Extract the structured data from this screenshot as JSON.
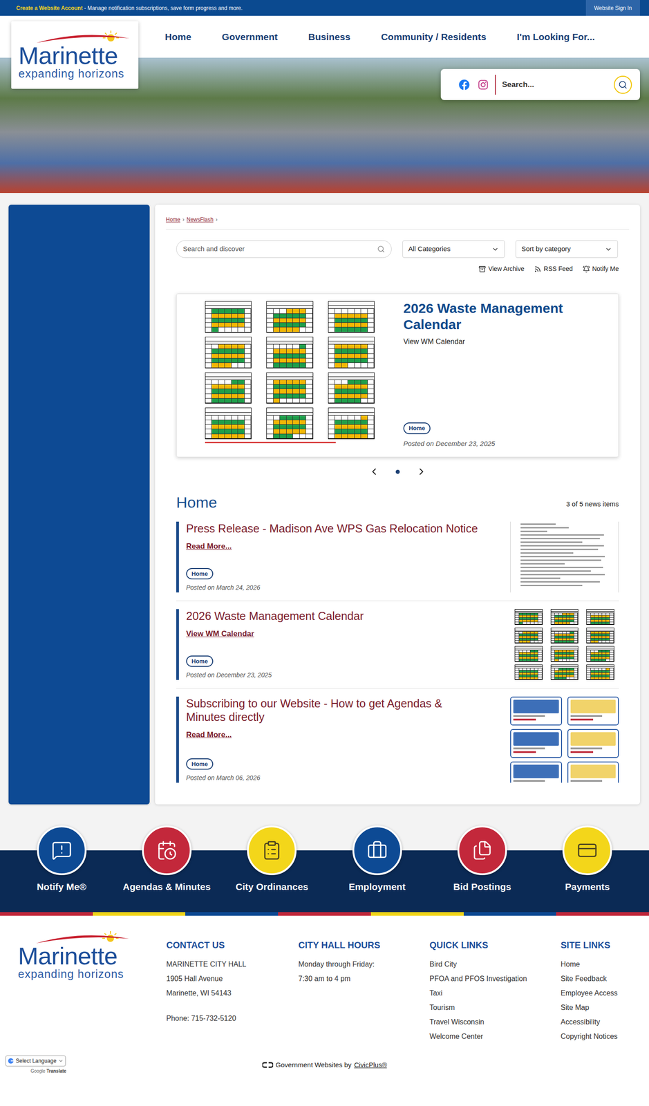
{
  "top_bar": {
    "account_link": "Create a Website Account",
    "message": " - Manage notification subscriptions, save form progress and more.",
    "sign_in": "Website Sign In"
  },
  "logo": {
    "name": "Marinette",
    "tagline": "expanding horizons"
  },
  "nav": [
    {
      "label": "Home"
    },
    {
      "label": "Government"
    },
    {
      "label": "Business"
    },
    {
      "label": "Community / Residents"
    },
    {
      "label": "I'm Looking For..."
    }
  ],
  "site_search": {
    "placeholder": "Search..."
  },
  "breadcrumb": {
    "items": [
      "Home",
      "NewsFlash"
    ],
    "separator": "›"
  },
  "filters": {
    "search_placeholder": "Search and discover",
    "category": "All Categories",
    "sort": "Sort by category"
  },
  "actions": [
    "View Archive",
    "RSS Feed",
    "Notify Me"
  ],
  "featured": {
    "title": "2026 Waste Management Calendar",
    "link": "View WM Calendar",
    "tag": "Home",
    "posted": "Posted on December 23, 2025"
  },
  "carousel": {
    "dots": [
      {
        "selected": true
      }
    ]
  },
  "section": {
    "title": "Home",
    "count": "3 of 5 news items"
  },
  "news": [
    {
      "title": "Press Release - Madison Ave WPS Gas Relocation Notice",
      "link": "Read More...",
      "tag": "Home",
      "posted": "Posted on March 24, 2026",
      "kind": "document"
    },
    {
      "title": "2026 Waste Management Calendar",
      "link": "View WM Calendar",
      "tag": "Home",
      "posted": "Posted on December 23, 2025",
      "kind": "calendar"
    },
    {
      "title": "Subscribing to our Website - How to get Agendas & Minutes directly",
      "link": "Read More...",
      "tag": "Home",
      "posted": "Posted on March 06, 2026",
      "kind": "screenshots"
    }
  ],
  "quick_links": [
    {
      "label": "Notify Me®",
      "color": "#0d4a94"
    },
    {
      "label": "Agendas & Minutes",
      "color": "#c3283b"
    },
    {
      "label": "City Ordinances",
      "color": "#f3d61a"
    },
    {
      "label": "Employment",
      "color": "#0d4a94"
    },
    {
      "label": "Bid Postings",
      "color": "#c3283b"
    },
    {
      "label": "Payments",
      "color": "#f3d61a"
    }
  ],
  "footer": {
    "contact": {
      "heading": "CONTACT US",
      "lines": [
        "MARINETTE CITY HALL",
        "1905 Hall Avenue",
        "Marinette, WI 54143"
      ],
      "phone": "Phone: 715-732-5120"
    },
    "hours": {
      "heading": "CITY HALL HOURS",
      "lines": [
        "Monday through Friday:",
        "7:30 am to 4 pm"
      ]
    },
    "quick_links": {
      "heading": "QUICK LINKS",
      "items": [
        "Bird City",
        "PFOA and PFOS Investigation",
        "Taxi",
        "Tourism",
        "Travel Wisconsin",
        "Welcome Center"
      ]
    },
    "site_links": {
      "heading": "SITE LINKS",
      "items": [
        "Home",
        "Site Feedback",
        "Employee Access",
        "Site Map",
        "Accessibility",
        "Copyright Notices"
      ]
    }
  },
  "translate": {
    "label": "Select Language",
    "brand": "Google",
    "service": "Translate"
  },
  "credit": {
    "text": "Government Websites by",
    "link": "CivicPlus®"
  }
}
